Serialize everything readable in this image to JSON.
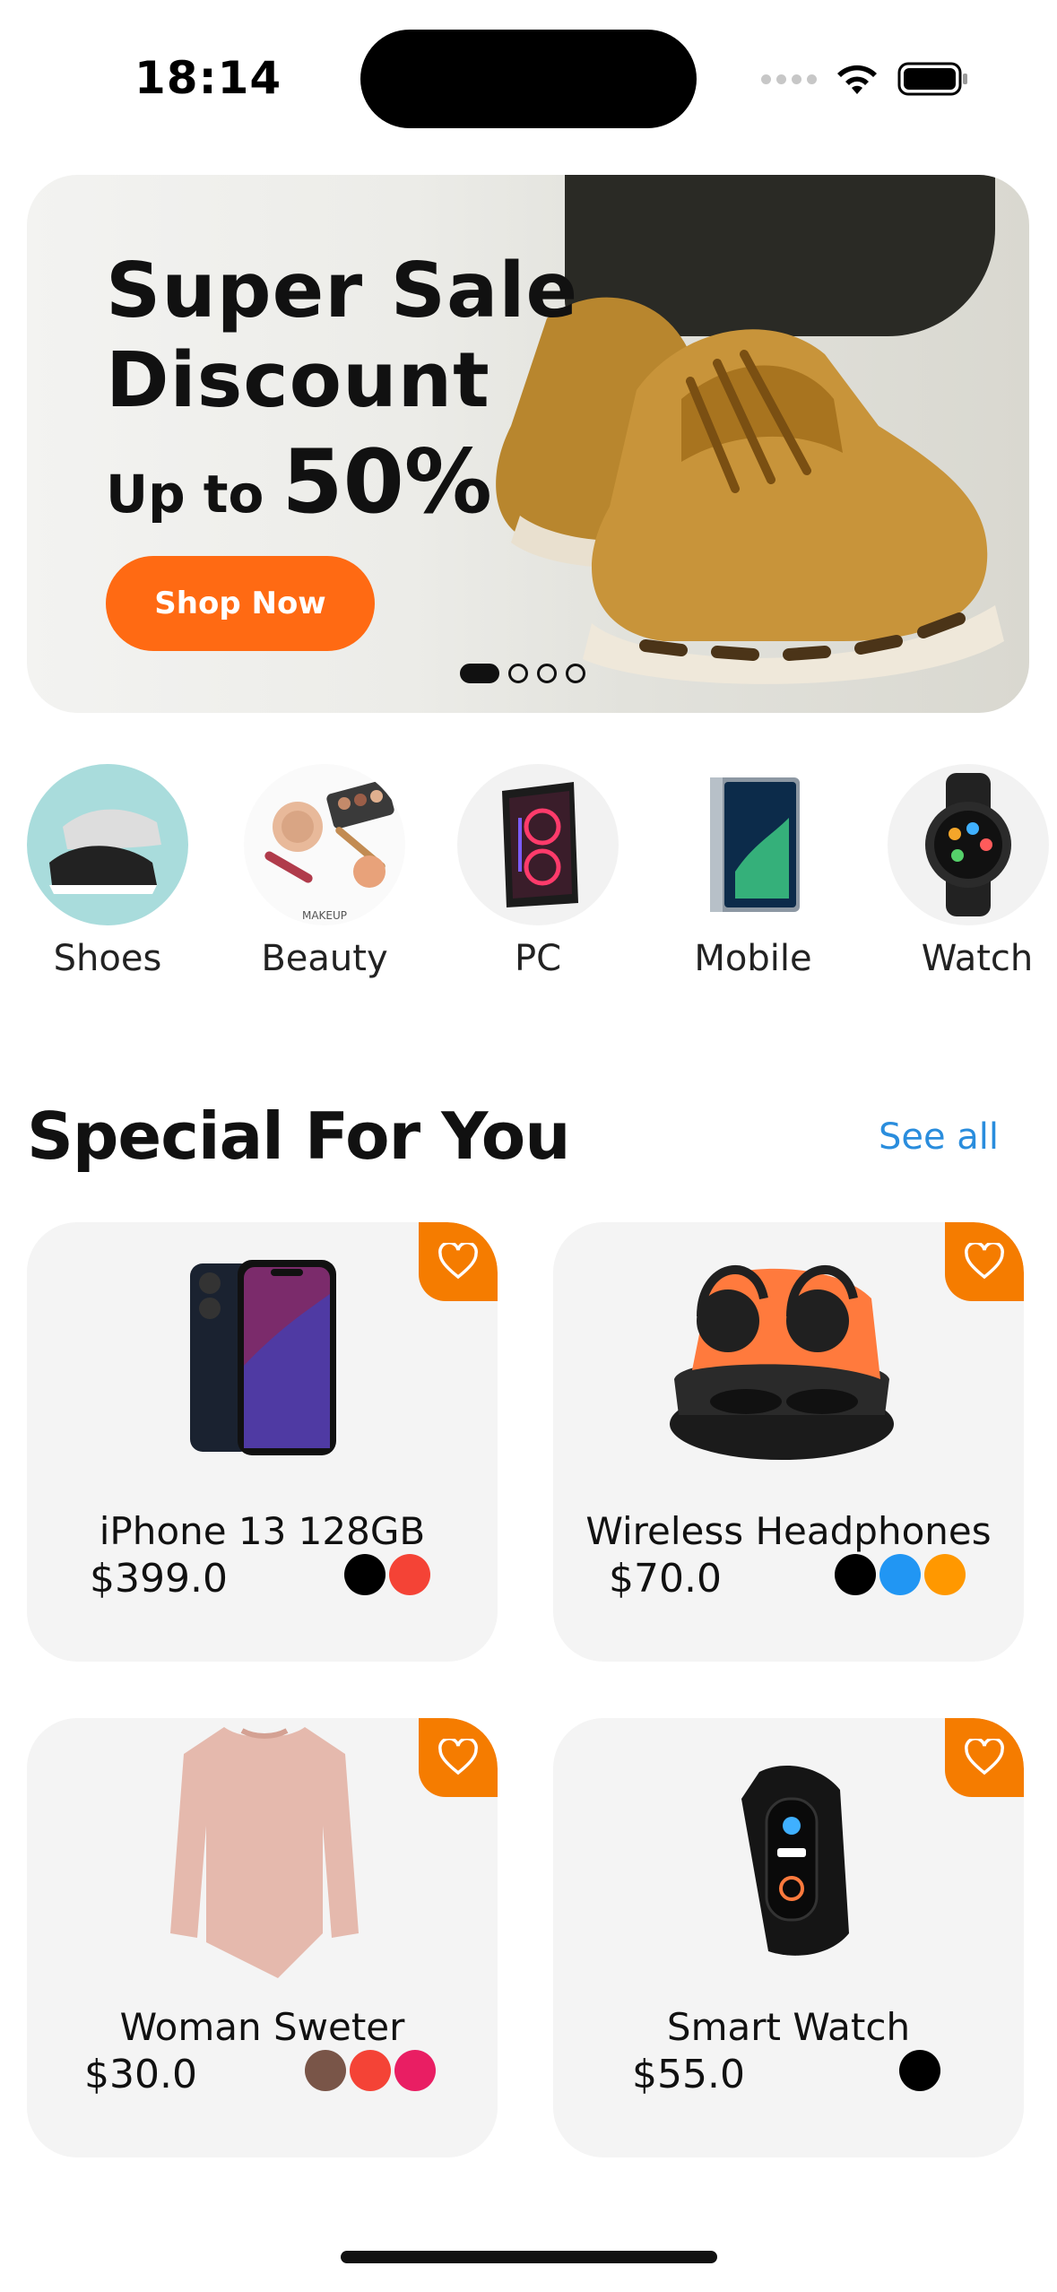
{
  "status_bar": {
    "time": "18:14"
  },
  "banner": {
    "line1": "Super Sale",
    "line2": "Discount",
    "up_to": "Up to",
    "percent": "50%",
    "cta": "Shop Now",
    "slides_total": 4,
    "active_slide": 1
  },
  "categories": [
    {
      "label": "Shoes",
      "icon": "sneakers-icon"
    },
    {
      "label": "Beauty",
      "icon": "makeup-icon"
    },
    {
      "label": "PC",
      "icon": "pc-tower-icon"
    },
    {
      "label": "Mobile",
      "icon": "smartphone-icon"
    },
    {
      "label": "Watch",
      "icon": "smartwatch-icon"
    }
  ],
  "beauty_caption": "MAKEUP",
  "section": {
    "title": "Special For You",
    "see_all": "See all"
  },
  "products": [
    {
      "name": "iPhone 13 128GB",
      "price": "$399.0",
      "colors": [
        "#000000",
        "#f44336"
      ]
    },
    {
      "name": "Wireless Headphones",
      "price": "$70.0",
      "colors": [
        "#000000",
        "#2196f3",
        "#ff9800"
      ]
    },
    {
      "name": "Woman Sweter",
      "price": "$30.0",
      "colors": [
        "#795548",
        "#f44336",
        "#e91e63"
      ]
    },
    {
      "name": "Smart Watch",
      "price": "$55.0",
      "colors": [
        "#000000"
      ]
    }
  ],
  "colors": {
    "accent": "#ff6a13",
    "favorite_bg": "#f57c00",
    "link": "#2a8ddd"
  }
}
